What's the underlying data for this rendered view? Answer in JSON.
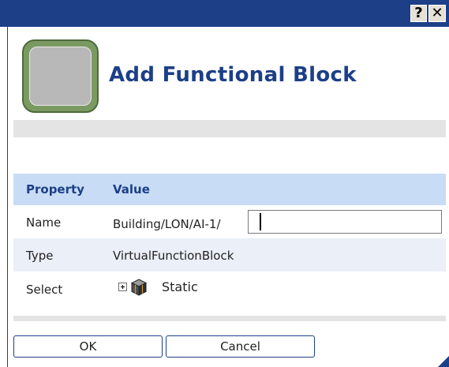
{
  "titlebar": {
    "help_label": "?",
    "close_label": "✕"
  },
  "header": {
    "title": "Add Functional Block",
    "icon": "functional-block-icon"
  },
  "table": {
    "columns": [
      "Property",
      "Value"
    ],
    "rows": [
      {
        "label": "Name",
        "value": "Building/LON/AI-1/"
      },
      {
        "label": "Type",
        "value": "VirtualFunctionBlock"
      },
      {
        "label": "Select",
        "value": "Static"
      }
    ]
  },
  "name_input": {
    "value": ""
  },
  "buttons": {
    "ok": "OK",
    "cancel": "Cancel"
  },
  "colors": {
    "titlebar": "#1c3f88",
    "header_row": "#c8dcf5",
    "accent_text": "#1c3f88"
  }
}
